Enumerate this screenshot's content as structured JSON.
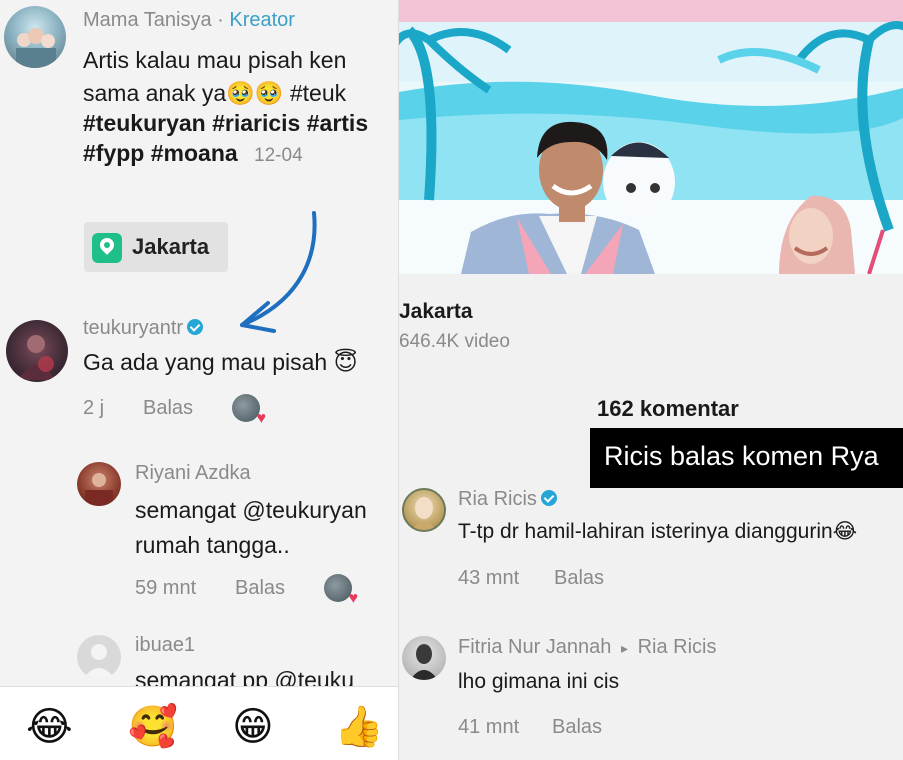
{
  "left": {
    "post": {
      "author": "Mama Tanisya",
      "separator": " · ",
      "author_badge": "Kreator",
      "lines": [
        "Artis kalau mau pisah ken",
        "sama anak ya🥹🥹 #teuk",
        "#teukuryan #riaricis #artis",
        "#fypp #moana"
      ],
      "date": "12-04",
      "location": "Jakarta"
    },
    "comment1": {
      "author": "teukuryantr",
      "text": "Ga ada yang mau pisah 😇",
      "time": "2 j",
      "reply_label": "Balas"
    },
    "comment2": {
      "author": "Riyani Azdka",
      "lines": [
        "semangat @teukuryan",
        "rumah tangga.."
      ],
      "time": "59 mnt",
      "reply_label": "Balas"
    },
    "comment3": {
      "author": "ibuae1",
      "text": "semangat pp @teuku"
    },
    "emoji_bar": [
      "😂",
      "🥰",
      "😁",
      "👍"
    ]
  },
  "right": {
    "location_title": "Jakarta",
    "video_count": "646.4K video",
    "comment_count": "162 komentar",
    "caption": "Ricis balas komen Rya",
    "comment1": {
      "author": "Ria Ricis",
      "text": "T-tp dr hamil-lahiran isterinya dianggurin😂",
      "time": "43 mnt",
      "reply_label": "Balas"
    },
    "comment2": {
      "author": "Fitria Nur Jannah",
      "reply_arrow": "▸",
      "reply_to": "Ria Ricis",
      "text": "lho gimana ini cis",
      "time": "41 mnt",
      "reply_label": "Balas"
    }
  },
  "colors": {
    "badge_blue": "#3aa0c8",
    "verified_blue": "#24a7d6",
    "location_green": "#1fbf8a",
    "annotation_arrow": "#1f6fc0",
    "caption_bg": "#000000"
  },
  "icons": [
    "location-pin-icon",
    "verified-icon",
    "annotation-arrow-icon",
    "like-avatar-icon"
  ]
}
